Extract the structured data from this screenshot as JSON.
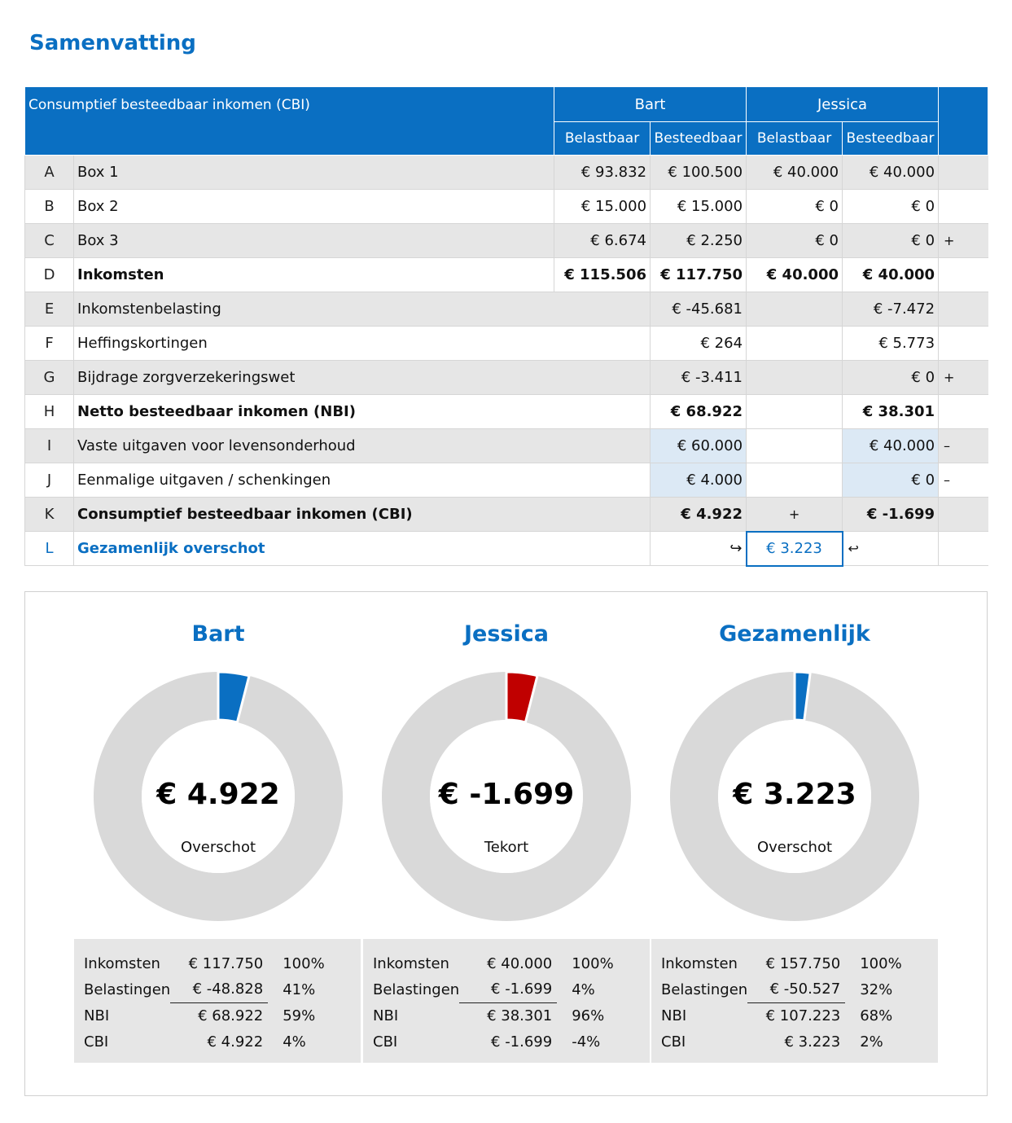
{
  "page": {
    "title": "Samenvatting"
  },
  "table": {
    "header": {
      "title": "Consumptief besteedbaar inkomen (CBI)",
      "person1": "Bart",
      "person2": "Jessica",
      "col_taxable": "Belastbaar",
      "col_spendable": "Besteedbaar"
    },
    "rows": {
      "A": {
        "letter": "A",
        "label": "Box 1",
        "b1": "€ 93.832",
        "b2": "€ 100.500",
        "j1": "€ 40.000",
        "j2": "€ 40.000"
      },
      "B": {
        "letter": "B",
        "label": "Box 2",
        "b1": "€ 15.000",
        "b2": "€ 15.000",
        "j1": "€ 0",
        "j2": "€ 0"
      },
      "C": {
        "letter": "C",
        "label": "Box 3",
        "b1": "€ 6.674",
        "b2": "€ 2.250",
        "j1": "€ 0",
        "j2": "€ 0",
        "side": "+"
      },
      "D": {
        "letter": "D",
        "label": "Inkomsten",
        "b1": "€ 115.506",
        "b2": "€ 117.750",
        "j1": "€ 40.000",
        "j2": "€ 40.000"
      },
      "E": {
        "letter": "E",
        "label": "Inkomstenbelasting",
        "b2": "€ -45.681",
        "j2": "€ -7.472"
      },
      "F": {
        "letter": "F",
        "label": "Heffingskortingen",
        "b2": "€ 264",
        "j2": "€ 5.773"
      },
      "G": {
        "letter": "G",
        "label": "Bijdrage zorgverzekeringswet",
        "b2": "€ -3.411",
        "j2": "€ 0",
        "side": "+"
      },
      "H": {
        "letter": "H",
        "label": "Netto besteedbaar inkomen (NBI)",
        "b2": "€ 68.922",
        "j2": "€ 38.301"
      },
      "I": {
        "letter": "I",
        "label": "Vaste uitgaven voor levensonderhoud",
        "b2": "€ 60.000",
        "j2": "€ 40.000",
        "side": "–"
      },
      "J": {
        "letter": "J",
        "label": "Eenmalige uitgaven / schenkingen",
        "b2": "€ 4.000",
        "j2": "€ 0",
        "side": "–"
      },
      "K": {
        "letter": "K",
        "label": "Consumptief besteedbaar inkomen (CBI)",
        "b2": "€ 4.922",
        "mid": "+",
        "j2": "€ -1.699"
      },
      "L": {
        "letter": "L",
        "label": "Gezamenlijk overschot",
        "left_arrow": "↪",
        "total": "€ 3.223",
        "right_arrow": "↩"
      }
    }
  },
  "charts": [
    {
      "title": "Bart",
      "value": "€ 4.922",
      "caption": "Overschot",
      "fraction": 0.04,
      "color": "#0a6fc2",
      "stats": [
        {
          "k": "Inkomsten",
          "v": "€ 117.750",
          "p": "100%"
        },
        {
          "k": "Belastingen",
          "v": "€ -48.828",
          "p": "41%"
        },
        {
          "k": "NBI",
          "v": "€ 68.922",
          "p": "59%"
        },
        {
          "k": "CBI",
          "v": "€ 4.922",
          "p": "4%"
        }
      ]
    },
    {
      "title": "Jessica",
      "value": "€ -1.699",
      "caption": "Tekort",
      "fraction": 0.04,
      "color": "#c00000",
      "stats": [
        {
          "k": "Inkomsten",
          "v": "€ 40.000",
          "p": "100%"
        },
        {
          "k": "Belastingen",
          "v": "€ -1.699",
          "p": "4%"
        },
        {
          "k": "NBI",
          "v": "€ 38.301",
          "p": "96%"
        },
        {
          "k": "CBI",
          "v": "€ -1.699",
          "p": "-4%"
        }
      ]
    },
    {
      "title": "Gezamenlijk",
      "value": "€ 3.223",
      "caption": "Overschot",
      "fraction": 0.02,
      "color": "#0a6fc2",
      "stats": [
        {
          "k": "Inkomsten",
          "v": "€ 157.750",
          "p": "100%"
        },
        {
          "k": "Belastingen",
          "v": "€ -50.527",
          "p": "32%"
        },
        {
          "k": "NBI",
          "v": "€ 107.223",
          "p": "68%"
        },
        {
          "k": "CBI",
          "v": "€ 3.223",
          "p": "2%"
        }
      ]
    }
  ],
  "colors": {
    "accent": "#0a6fc2",
    "deficit": "#c00000",
    "ring": "#d9d9d9",
    "row_grey": "#e6e6e6",
    "input_blue": "#dce9f5"
  }
}
